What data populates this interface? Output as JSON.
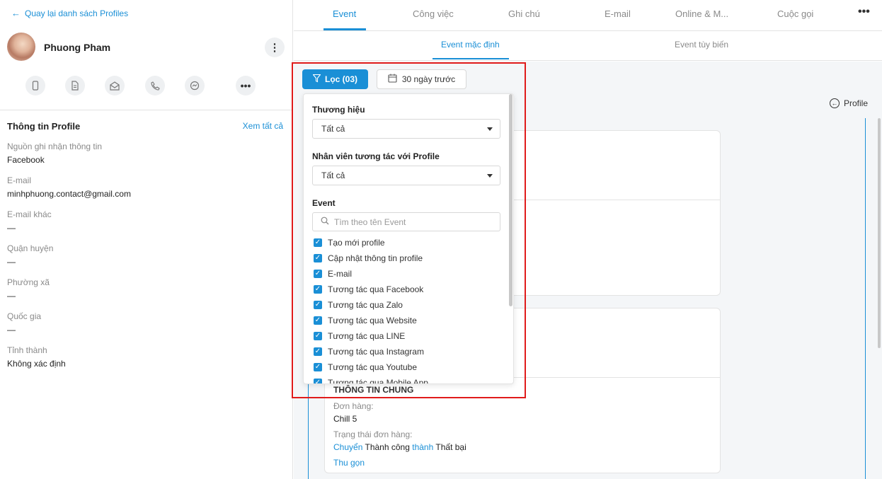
{
  "sidebar": {
    "back_label": "Quay lại danh sách Profiles",
    "profile_name": "Phuong Pham",
    "contact_icons": [
      "mobile-icon",
      "document-icon",
      "mail-open-icon",
      "phone-icon",
      "messenger-icon",
      "more-icon"
    ],
    "info_title": "Thông tin Profile",
    "see_all": "Xem tất cả",
    "fields": [
      {
        "label": "Nguồn ghi nhận thông tin",
        "value": "Facebook"
      },
      {
        "label": "E-mail",
        "value": "minhphuong.contact@gmail.com"
      },
      {
        "label": "E-mail khác",
        "value": "—"
      },
      {
        "label": "Quận huyện",
        "value": "—"
      },
      {
        "label": "Phường xã",
        "value": "—"
      },
      {
        "label": "Quốc gia",
        "value": "—"
      },
      {
        "label": "Tỉnh thành",
        "value": "Không xác định"
      }
    ]
  },
  "tabs": [
    {
      "label": "Event",
      "active": true
    },
    {
      "label": "Công việc"
    },
    {
      "label": "Ghi chú"
    },
    {
      "label": "E-mail"
    },
    {
      "label": "Online & M..."
    },
    {
      "label": "Cuộc gọi"
    }
  ],
  "subtabs": [
    {
      "label": "Event mặc định",
      "active": true
    },
    {
      "label": "Event tùy biến"
    }
  ],
  "toolbar": {
    "filter_label": "Lọc (03)",
    "date_label": "30 ngày trước"
  },
  "profile_link": "Profile",
  "filter_panel": {
    "brand_label": "Thương hiệu",
    "brand_value": "Tất cả",
    "staff_label": "Nhân viên tương tác với Profile",
    "staff_value": "Tất cả",
    "event_label": "Event",
    "search_placeholder": "Tìm theo tên Event",
    "events": [
      "Tạo mới profile",
      "Cập nhật thông tin profile",
      "E-mail",
      "Tương tác qua Facebook",
      "Tương tác qua Zalo",
      "Tương tác qua Website",
      "Tương tác qua LINE",
      "Tương tác qua Instagram",
      "Tương tác qua Youtube",
      "Tương tác qua Mobile App"
    ]
  },
  "card": {
    "section_title": "THÔNG TIN CHUNG",
    "order_label": "Đơn hàng:",
    "order_value": "Chill 5",
    "status_label": "Trạng thái đơn hàng:",
    "status_parts": [
      "Chuyển",
      "Thành công",
      "thành",
      "Thất bại"
    ],
    "collapse": "Thu gọn"
  },
  "colors": {
    "accent": "#1a8fd6",
    "highlight": "#e01b1b"
  }
}
